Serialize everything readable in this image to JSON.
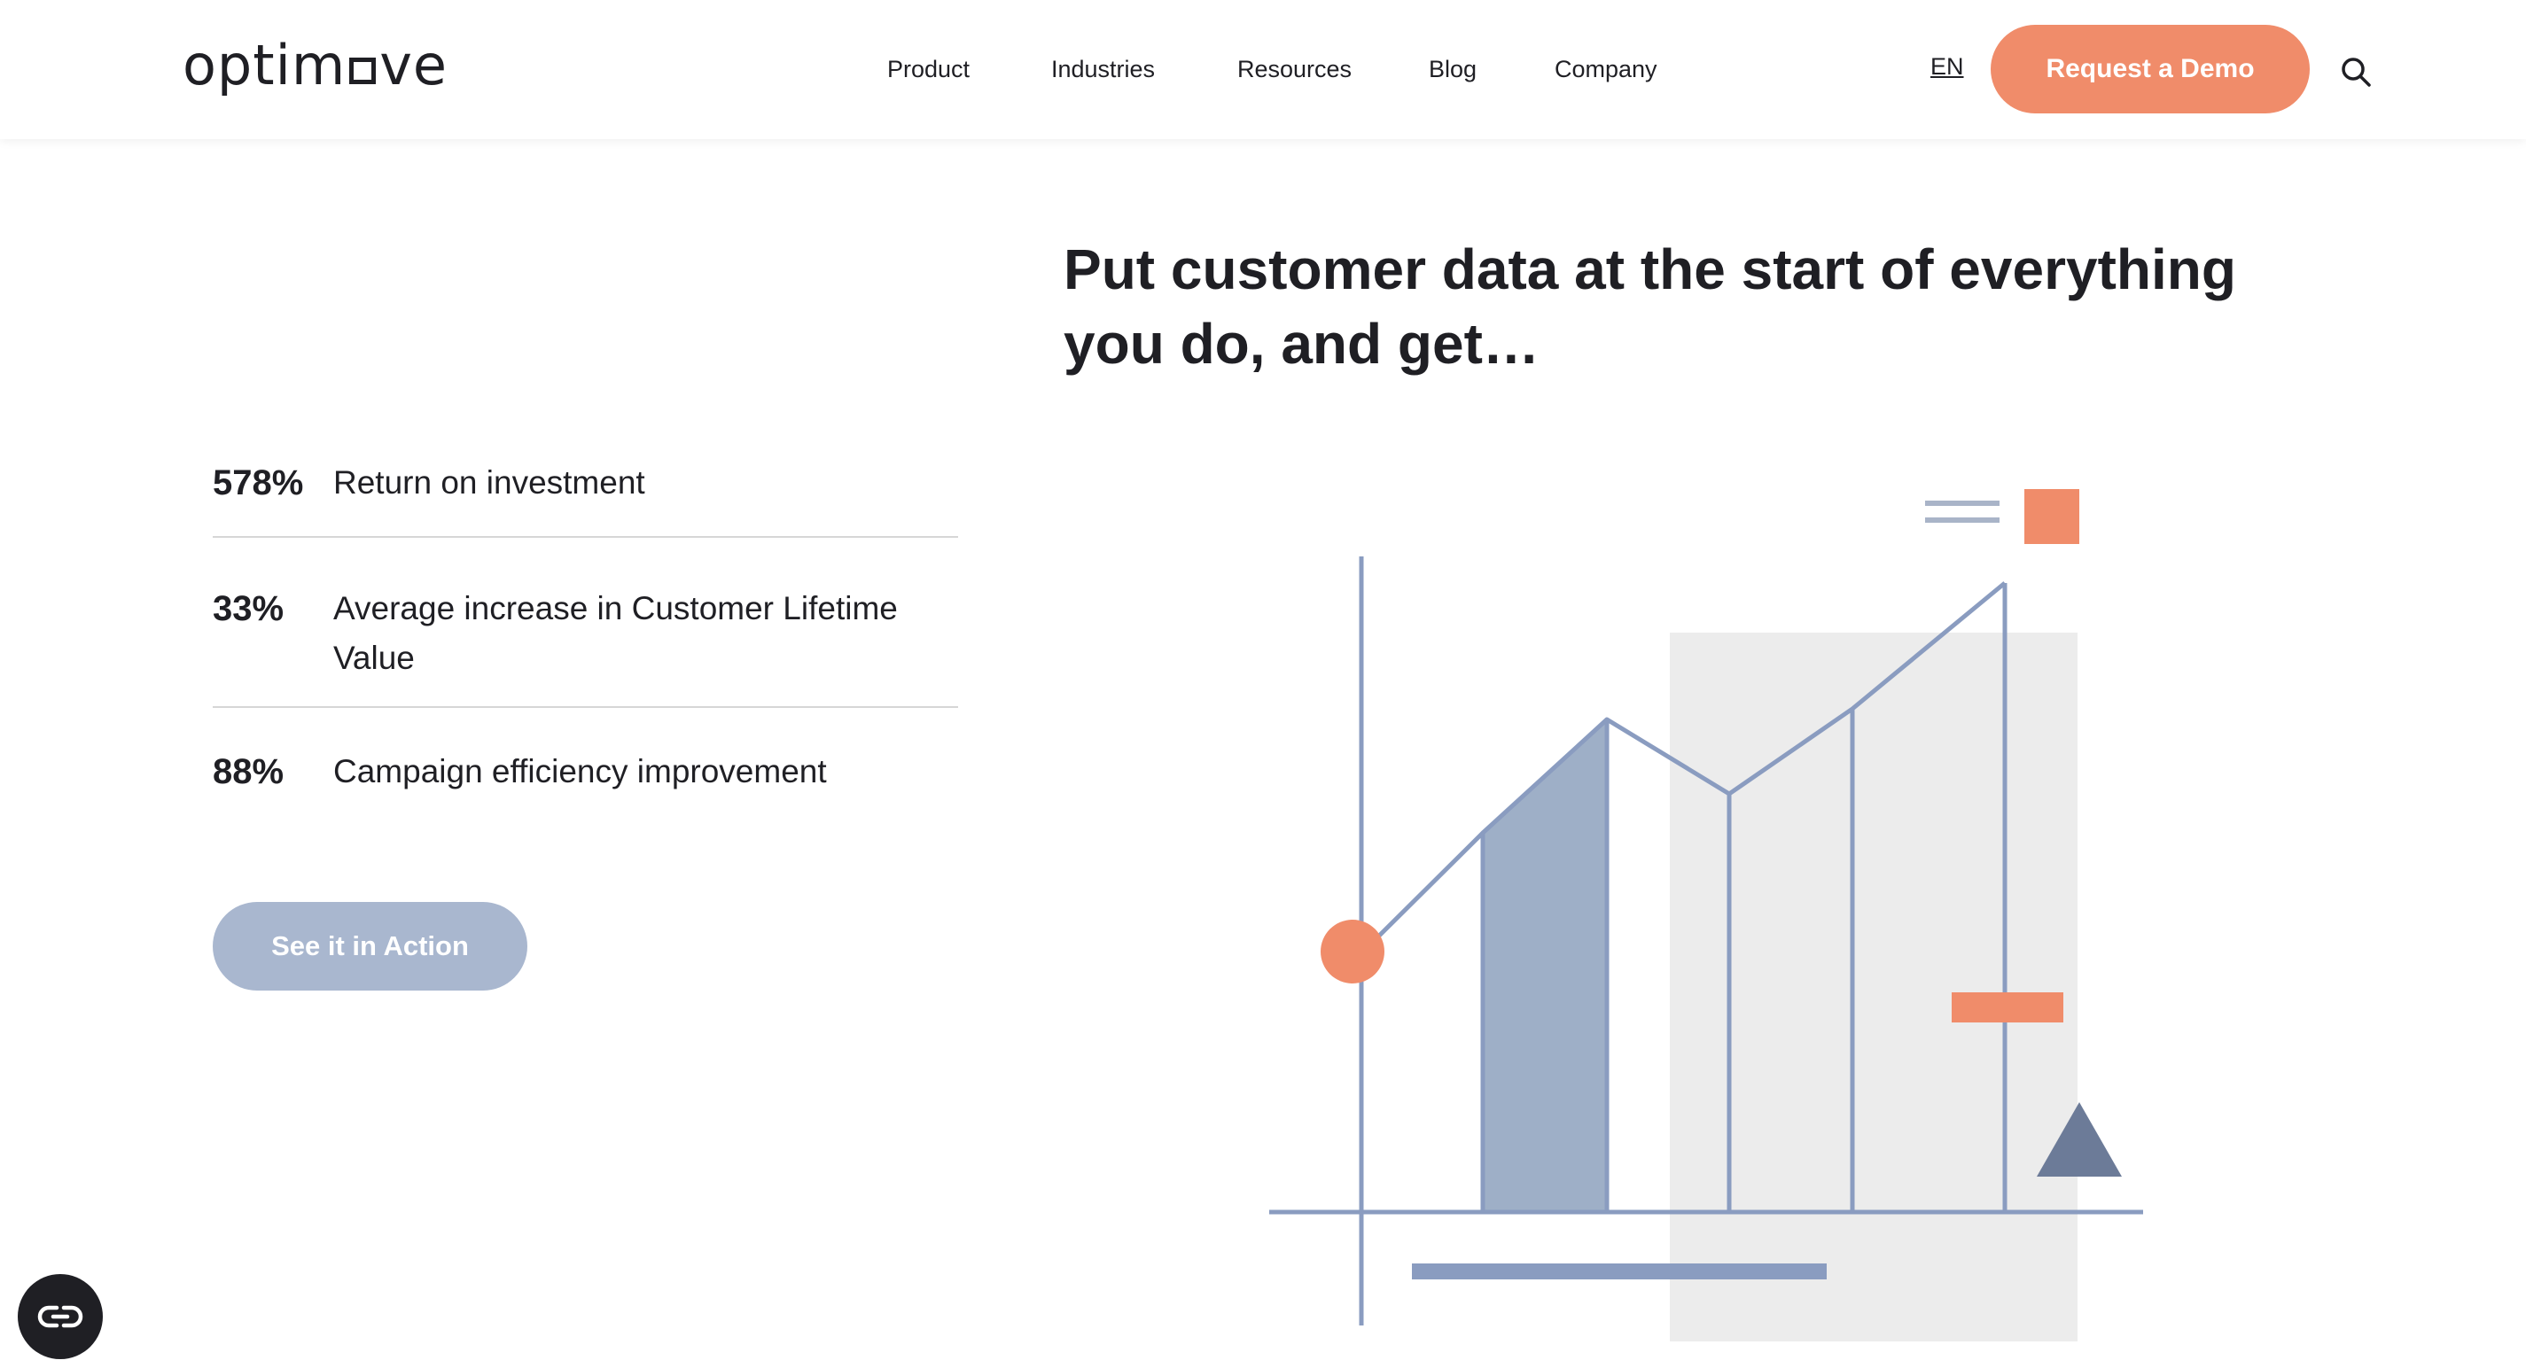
{
  "header": {
    "logo": {
      "before": "optim",
      "after": "ve"
    },
    "nav": [
      {
        "label": "Product"
      },
      {
        "label": "Industries"
      },
      {
        "label": "Resources"
      },
      {
        "label": "Blog"
      },
      {
        "label": "Company"
      }
    ],
    "language": "EN",
    "demo_button": "Request a Demo"
  },
  "hero": {
    "headline": "Put customer data at the start of everything you do, and get…"
  },
  "stats": [
    {
      "value": "578%",
      "label": "Return on investment"
    },
    {
      "value": "33%",
      "label": "Average increase in Customer Lifetime Value"
    },
    {
      "value": "88%",
      "label": "Campaign efficiency improvement"
    }
  ],
  "cta": {
    "action_button": "See it in Action"
  },
  "colors": {
    "accent": "#f08c6a",
    "slate": "#8a9cc0",
    "slate_fill": "#9eafc7",
    "panel_gray": "#ececec",
    "triangle": "#6c7b98",
    "text": "#1f1f24"
  }
}
